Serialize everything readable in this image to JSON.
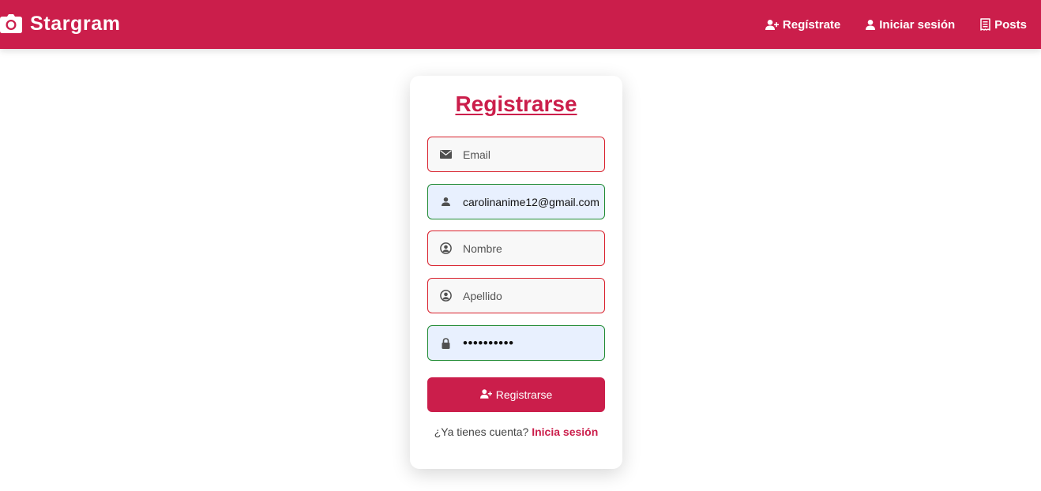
{
  "app": {
    "brand_name": "Stargram",
    "brand_color": "#cb1e4b",
    "brand_icon": "camera-icon"
  },
  "nav": {
    "links": [
      {
        "label": "Regístrate",
        "icon": "user-plus-icon"
      },
      {
        "label": "Iniciar sesión",
        "icon": "user-icon"
      },
      {
        "label": "Posts",
        "icon": "receipt-icon"
      }
    ]
  },
  "form": {
    "title": "Registrarse",
    "fields": [
      {
        "name": "email",
        "placeholder": "Email",
        "value": "",
        "icon": "envelope-icon",
        "state": "invalid"
      },
      {
        "name": "username",
        "placeholder": "",
        "value": "carolinanime12@gmail.com",
        "icon": "user-icon",
        "state": "valid"
      },
      {
        "name": "nombre",
        "placeholder": "Nombre",
        "value": "",
        "icon": "user-circle-icon",
        "state": "invalid"
      },
      {
        "name": "apellido",
        "placeholder": "Apellido",
        "value": "",
        "icon": "user-circle-icon",
        "state": "invalid"
      },
      {
        "name": "password",
        "placeholder": "",
        "value": "••••••••••",
        "icon": "lock-icon",
        "state": "valid"
      }
    ],
    "submit_label": "Registrarse",
    "submit_icon": "user-plus-icon",
    "footer_text": "¿Ya tienes cuenta?",
    "footer_link": "Inicia sesión",
    "colors": {
      "invalid_border": "#d9202c",
      "valid_border": "#1e8a33",
      "autofill_bg": "#e8f0fe"
    }
  }
}
